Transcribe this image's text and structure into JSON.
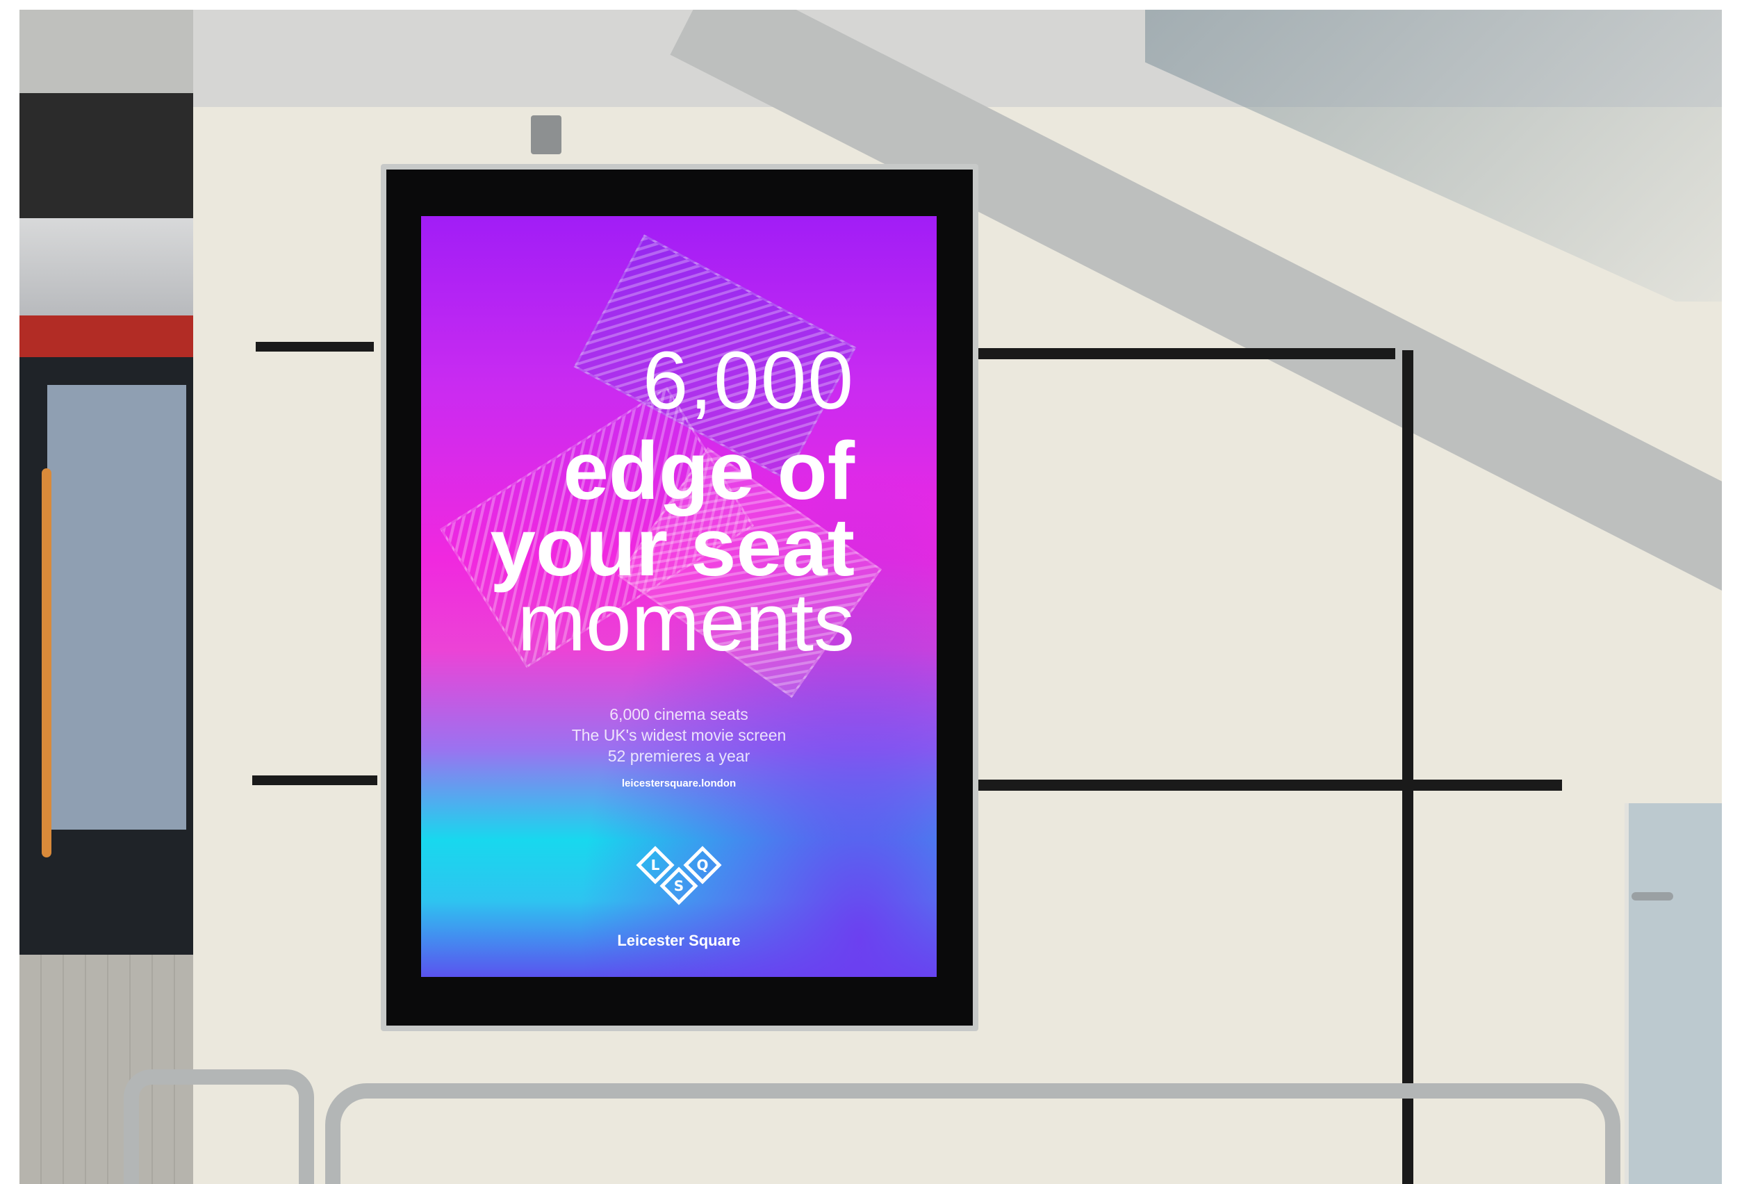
{
  "billboard": {
    "headline": {
      "number": "6,000",
      "line1": "edge of",
      "line2": "your seat",
      "line3": "moments"
    },
    "sub_lines": [
      "6,000 cinema seats",
      "The UK's widest movie screen",
      "52 premieres a year"
    ],
    "website": "leicestersquare.london",
    "logo": {
      "icon": "lsq-diamond-logo-icon",
      "letters": [
        "L",
        "S",
        "Q"
      ]
    },
    "brand_name": "Leicester Square"
  },
  "colors": {
    "screen_top": "#a11df6",
    "screen_mid": "#f028df",
    "screen_cyan": "#18d8ee",
    "screen_bottom": "#5a53ef",
    "bezel": "#0a0a0b",
    "wall": "#ebe8dd"
  }
}
